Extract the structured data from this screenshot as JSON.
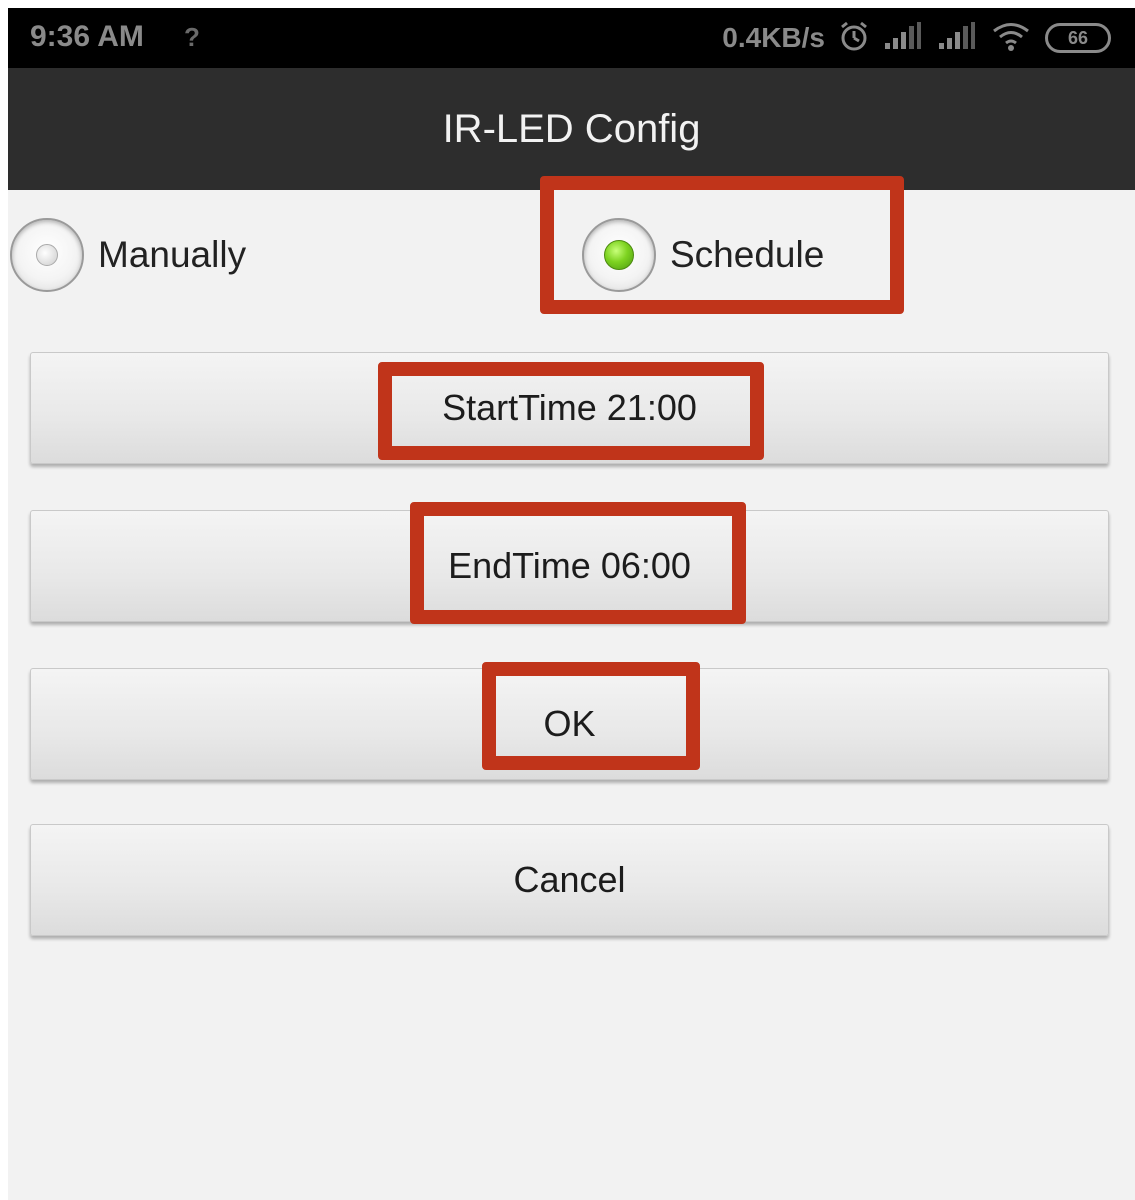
{
  "status_bar": {
    "time": "9:36 AM",
    "unknown_icon": "?",
    "network_speed": "0.4KB/s",
    "battery_level": "66",
    "icons": [
      "alarm-icon",
      "signal-icon",
      "signal-icon",
      "wifi-icon",
      "battery-icon"
    ]
  },
  "title": "IR-LED Config",
  "mode": {
    "options": [
      {
        "label": "Manually",
        "selected": false
      },
      {
        "label": "Schedule",
        "selected": true
      }
    ]
  },
  "buttons": {
    "start_time": "StartTime 21:00",
    "end_time": "EndTime 06:00",
    "ok": "OK",
    "cancel": "Cancel"
  },
  "colors": {
    "status_bar_bg": "#000000",
    "title_bar_bg": "#2d2d2d",
    "screen_bg": "#f2f2f2",
    "highlight": "#c0341a",
    "radio_selected": "#7ed321"
  }
}
